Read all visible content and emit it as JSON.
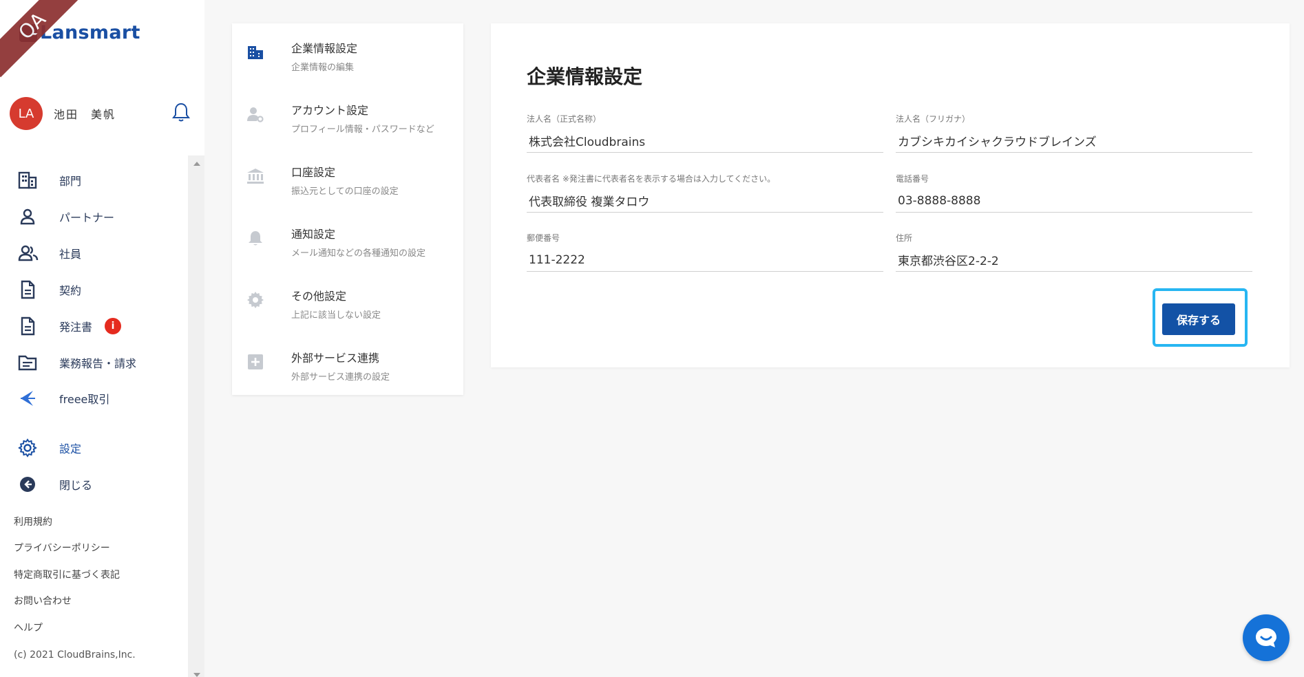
{
  "app": {
    "logo_text": "Lansmart",
    "qa_badge": "QA"
  },
  "user": {
    "initials": "LA",
    "name": "池田　美帆"
  },
  "nav": {
    "items": [
      {
        "label": "部門",
        "icon": "building-icon"
      },
      {
        "label": "パートナー",
        "icon": "person-icon"
      },
      {
        "label": "社員",
        "icon": "people-icon"
      },
      {
        "label": "契約",
        "icon": "document-icon"
      },
      {
        "label": "発注書",
        "icon": "document-icon",
        "badge": "i"
      },
      {
        "label": "業務報告・請求",
        "icon": "folder-icon"
      },
      {
        "label": "freee取引",
        "icon": "freee-icon"
      },
      {
        "label": "設定",
        "icon": "gear-icon",
        "active": true
      },
      {
        "label": "閉じる",
        "icon": "arrow-left-circle-icon"
      }
    ]
  },
  "footer": {
    "links": [
      "利用規約",
      "プライバシーポリシー",
      "特定商取引に基づく表記",
      "お問い合わせ",
      "ヘルプ"
    ],
    "copyright": "(c) 2021 CloudBrains,Inc."
  },
  "settings_menu": [
    {
      "title": "企業情報設定",
      "desc": "企業情報の編集",
      "icon": "building-icon"
    },
    {
      "title": "アカウント設定",
      "desc": "プロフィール情報・パスワードなど",
      "icon": "user-gear-icon"
    },
    {
      "title": "口座設定",
      "desc": "振込元としての口座の設定",
      "icon": "bank-icon"
    },
    {
      "title": "通知設定",
      "desc": "メール通知などの各種通知の設定",
      "icon": "bell-icon"
    },
    {
      "title": "その他設定",
      "desc": "上記に該当しない設定",
      "icon": "gear-icon"
    },
    {
      "title": "外部サービス連携",
      "desc": "外部サービス連携の設定",
      "icon": "plus-box-icon"
    }
  ],
  "form": {
    "title": "企業情報設定",
    "fields": {
      "corp_name": {
        "label": "法人名（正式名称）",
        "value": "株式会社Cloudbrains"
      },
      "corp_kana": {
        "label": "法人名（フリガナ）",
        "value": "カブシキカイシャクラウドブレインズ"
      },
      "rep_name": {
        "label": "代表者名 ※発注書に代表者名を表示する場合は入力してください。",
        "value": "代表取締役 複業タロウ"
      },
      "phone": {
        "label": "電話番号",
        "value": "03-8888-8888"
      },
      "postal": {
        "label": "郵便番号",
        "value": "111-2222"
      },
      "address": {
        "label": "住所",
        "value": "東京都渋谷区2-2-2"
      }
    },
    "save_label": "保存する"
  },
  "colors": {
    "accent": "#1352a6",
    "focus": "#27b6f2",
    "badge": "#e52b1f",
    "avatar": "#d63b2f"
  }
}
